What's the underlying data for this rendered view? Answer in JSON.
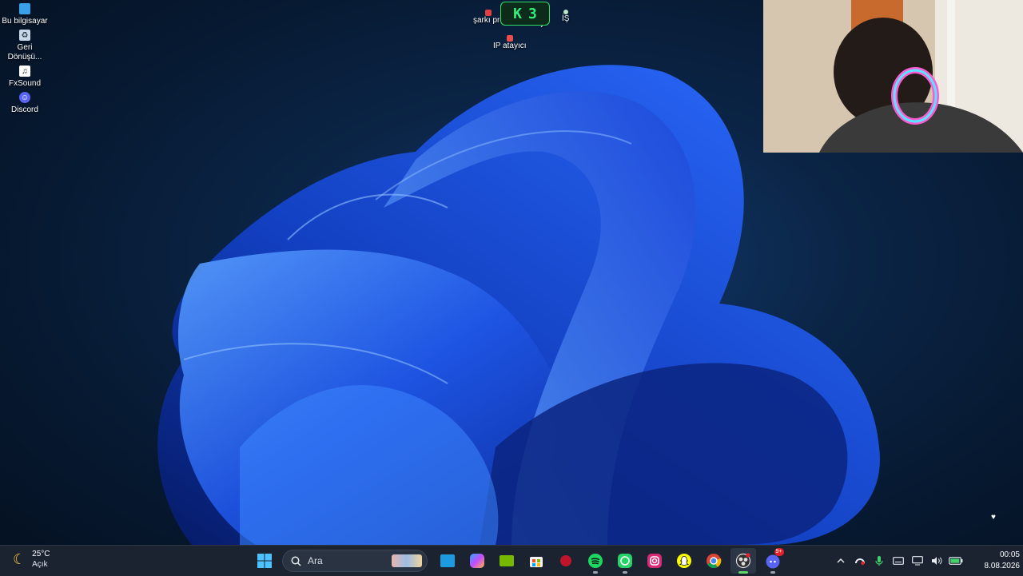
{
  "desktop": {
    "icons": [
      {
        "label": "Bu bilgisayar",
        "icon": "computer-icon"
      },
      {
        "label": "Geri Dönüşü...",
        "icon": "recycle-bin-icon"
      },
      {
        "label": "FxSound",
        "icon": "fxsound-icon"
      },
      {
        "label": "Discord",
        "icon": "discord-icon"
      }
    ],
    "center_icons": [
      {
        "label": "şarkı pro",
        "icon": "file-icon"
      },
      {
        "label": "je",
        "icon": "file-icon"
      },
      {
        "label": "İŞ",
        "icon": "folder-icon"
      },
      {
        "label": "IP atayıcı",
        "icon": "network-icon"
      }
    ],
    "overlay": {
      "key": "K",
      "value": "3"
    },
    "tray_corner": {
      "glyph": "♥"
    }
  },
  "taskbar": {
    "weather": {
      "temp": "25°C",
      "condition": "Açık",
      "icon": "moon-icon"
    },
    "search": {
      "placeholder": "Ara"
    },
    "apps": [
      "start-icon",
      "file-explorer-icon",
      "copilot-icon",
      "nvidia-icon",
      "microsoft-store-icon",
      "app-red-icon",
      "spotify-icon",
      "whatsapp-icon",
      "instagram-icon",
      "snapchat-icon",
      "chrome-icon",
      "obs-icon",
      "discord-icon"
    ],
    "discord_badge": "9+",
    "tray": [
      "chevron-up-icon",
      "vpn-icon",
      "microphone-icon",
      "keyboard-icon",
      "display-icon",
      "volume-icon",
      "battery-icon"
    ],
    "clock": {
      "time": "00:05",
      "date": "8.08.2026"
    }
  },
  "colors": {
    "taskbar": "#1b2230",
    "accent_green": "#34f07a",
    "bloom": "#1e4fe0"
  }
}
